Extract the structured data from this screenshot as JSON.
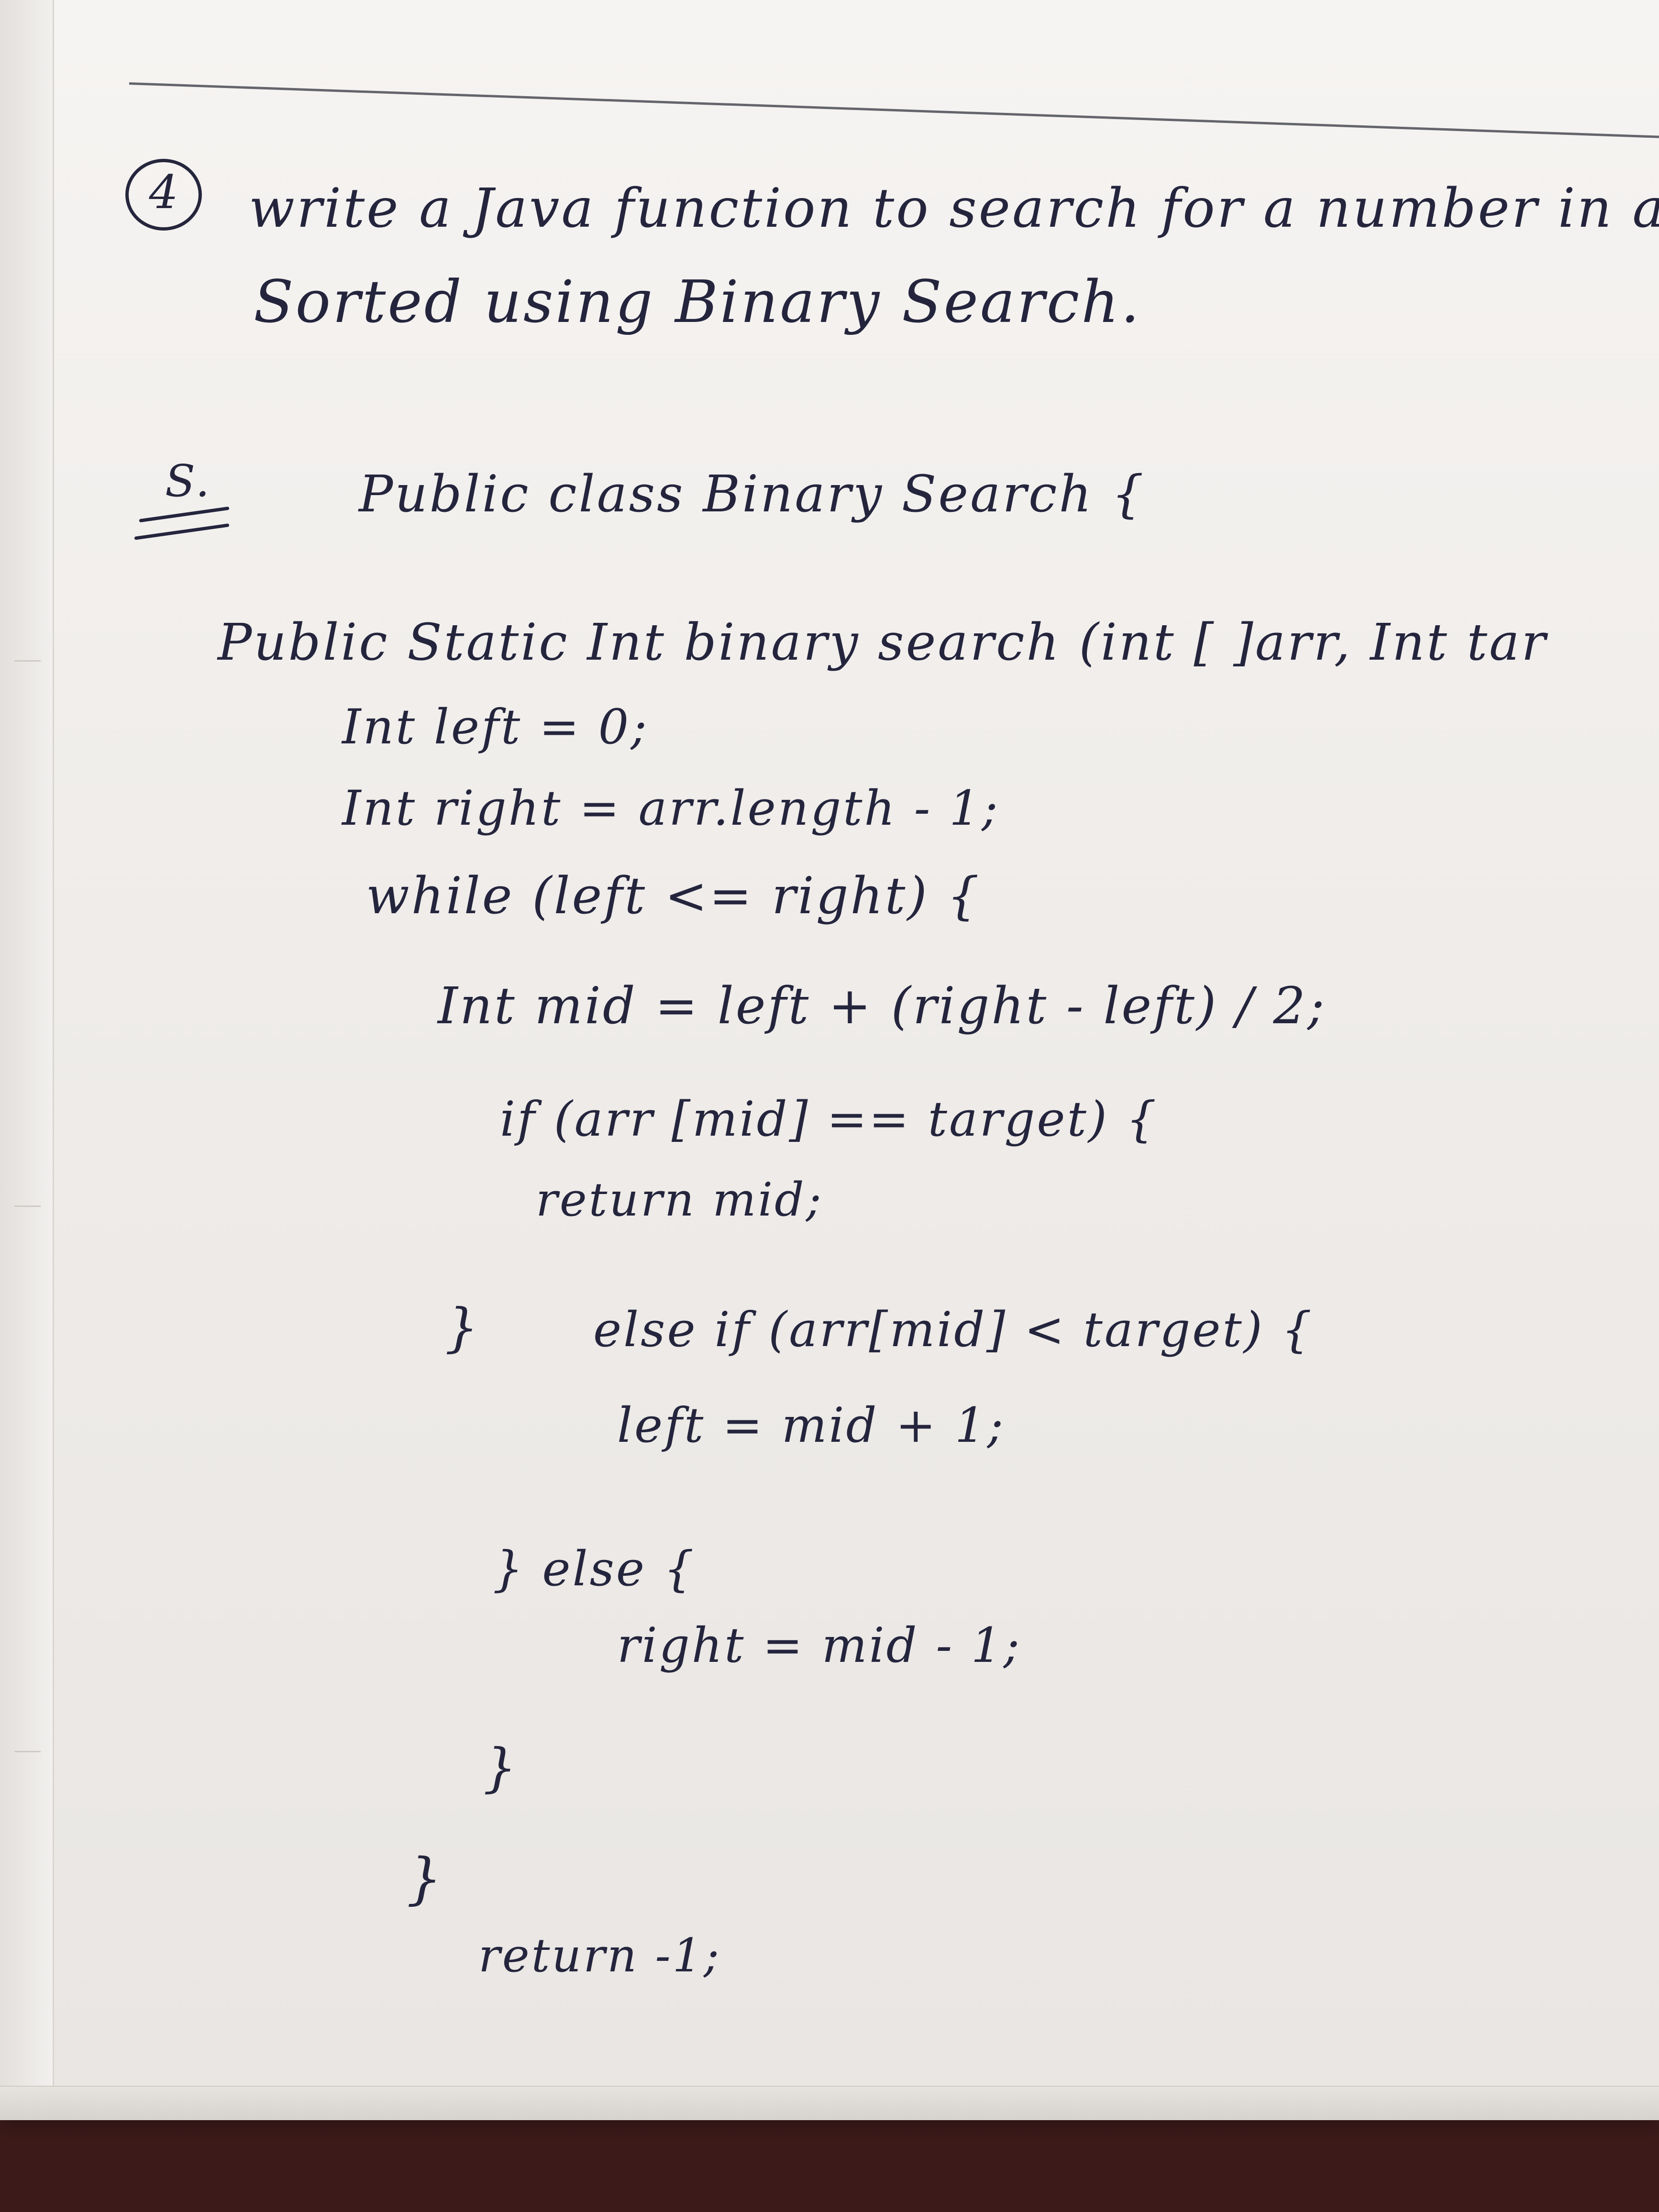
{
  "question": {
    "number": "4",
    "line_1": "write a Java function to search for a number in a",
    "line_2": "Sorted using Binary Search."
  },
  "solution": {
    "label": "S.",
    "code_lines": [
      "Public class Binary Search {",
      "Public Static Int binary search (int [ ]arr, Int tar",
      "Int left = 0;",
      "Int right = arr.length - 1;",
      "while (left <= right) {",
      "Int mid = left + (right - left) / 2;",
      "if (arr [mid] == target) {",
      "return mid;",
      "}",
      "else if (arr[mid] < target) {",
      "left = mid + 1;",
      "} else {",
      "right = mid - 1;",
      "}",
      "}",
      "return -1;"
    ]
  }
}
